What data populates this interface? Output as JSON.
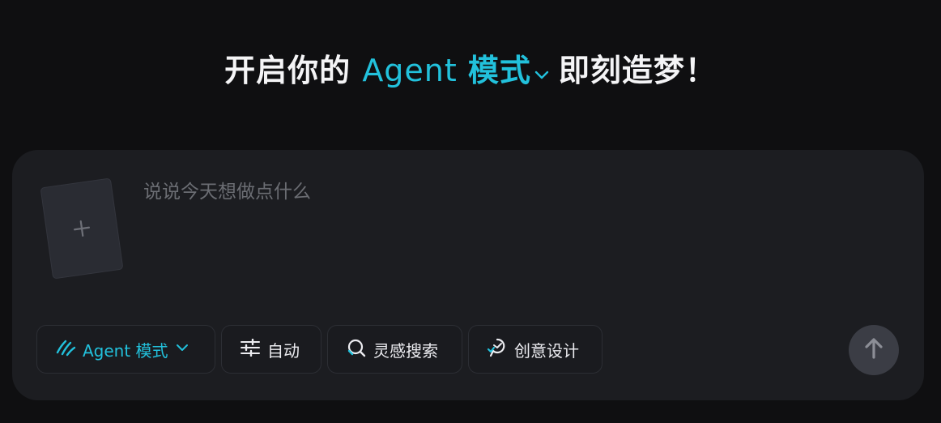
{
  "headline": {
    "prefix": "开启你的 ",
    "mode_latin": "Agent ",
    "mode_cjk": "模式",
    "suffix": "即刻造梦！",
    "mode_color": "#22c1dc"
  },
  "composer": {
    "placeholder": "说说今天想做点什么",
    "upload_icon": "plus-icon"
  },
  "toolbar": {
    "agent_mode_label": "Agent 模式",
    "auto_label": "自动",
    "inspiration_search_label": "灵感搜索",
    "creative_design_label": "创意设计",
    "send_icon": "arrow-up-icon"
  },
  "colors": {
    "background": "#0f0f11",
    "panel": "#1c1d21",
    "accent": "#22c1dc",
    "send_button": "#3b3d45"
  }
}
